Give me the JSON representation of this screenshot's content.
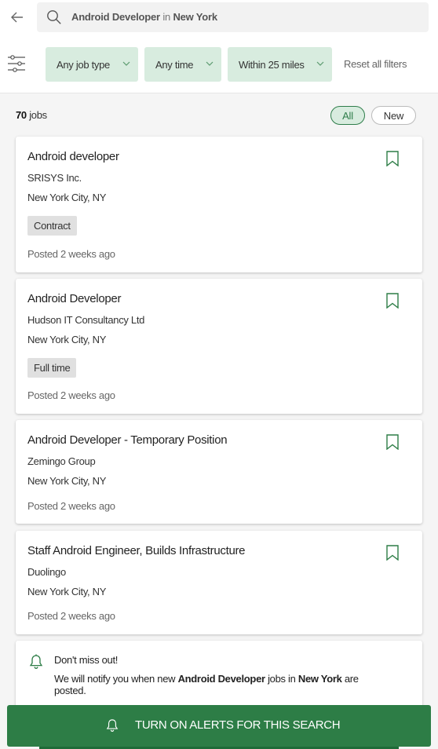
{
  "search": {
    "keyword": "Android Developer",
    "connector": "in",
    "location": "New York"
  },
  "filters": {
    "job_type": "Any job type",
    "time": "Any time",
    "distance": "Within 25 miles",
    "reset": "Reset all filters"
  },
  "results": {
    "count": "70",
    "count_label": "jobs",
    "toggle_all": "All",
    "toggle_new": "New"
  },
  "jobs": [
    {
      "title": "Android developer",
      "company": "SRISYS Inc.",
      "location": "New York City, NY",
      "tag": "Contract",
      "posted": "Posted 2 weeks ago"
    },
    {
      "title": "Android Developer",
      "company": "Hudson IT Consultancy Ltd",
      "location": "New York City, NY",
      "tag": "Full time",
      "posted": "Posted 2 weeks ago"
    },
    {
      "title": "Android Developer - Temporary Position",
      "company": "Zemingo Group",
      "location": "New York City, NY",
      "posted": "Posted 2 weeks ago"
    },
    {
      "title": "Staff Android Engineer, Builds Infrastructure",
      "company": "Duolingo",
      "location": "New York City, NY",
      "posted": "Posted 2 weeks ago"
    }
  ],
  "alert": {
    "heading": "Don't miss out!",
    "msg_pre": "We will notify you when new",
    "msg_keyword": "Android Developer",
    "msg_mid": "jobs in",
    "msg_location": "New York",
    "msg_post": "are posted."
  },
  "cta": {
    "label": "TURN ON ALERTS FOR THIS SEARCH"
  },
  "icons": {
    "back": "arrow-left-icon",
    "search": "search-icon",
    "filters": "sliders-icon",
    "chevron": "chevron-down-icon",
    "bookmark": "bookmark-icon",
    "bell": "bell-icon"
  },
  "colors": {
    "accent": "#2d7d46",
    "chip_bg": "#d8ecdf"
  }
}
